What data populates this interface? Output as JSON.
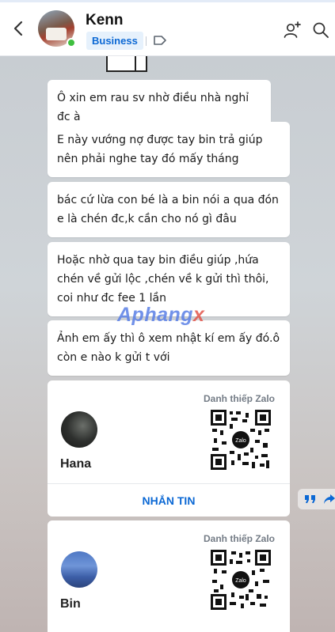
{
  "header": {
    "contact_name": "Kenn",
    "badge": "Business",
    "icons": [
      "back-chevron-icon",
      "tag-icon",
      "add-friend-icon",
      "search-icon"
    ]
  },
  "messages": [
    {
      "text": "Ô xin em rau sv nhờ điều nhà nghỉ đc à"
    },
    {
      "text": "E này vướng nợ được tay bin  trả giúp nên phải nghe tay đó mấy tháng"
    },
    {
      "text": "bác cứ lừa con bé là a bin nói a qua đón e là chén đc,k cần cho nó gì đâu"
    },
    {
      "text": "Hoặc nhờ qua tay bin điều giúp ,hứa chén về gửi lộc ,chén về k gửi thì thôi, coi như đc fee 1 lần"
    },
    {
      "text": "Ảnh em ấy thì ô xem nhật kí em ấy đó.ô còn e nào k gửi t với"
    }
  ],
  "watermark": {
    "main": "Aphang",
    "accent": "x"
  },
  "cards": [
    {
      "label": "Danh thiếp Zalo",
      "name": "Hana",
      "qr_logo": "Zalo",
      "action": "NHẮN TIN"
    },
    {
      "label": "Danh thiếp Zalo",
      "name": "Bin",
      "qr_logo": "Zalo"
    }
  ],
  "colors": {
    "accent": "#0b68d4",
    "badge_bg": "#e6f1fc",
    "online": "#3fbf3f"
  }
}
